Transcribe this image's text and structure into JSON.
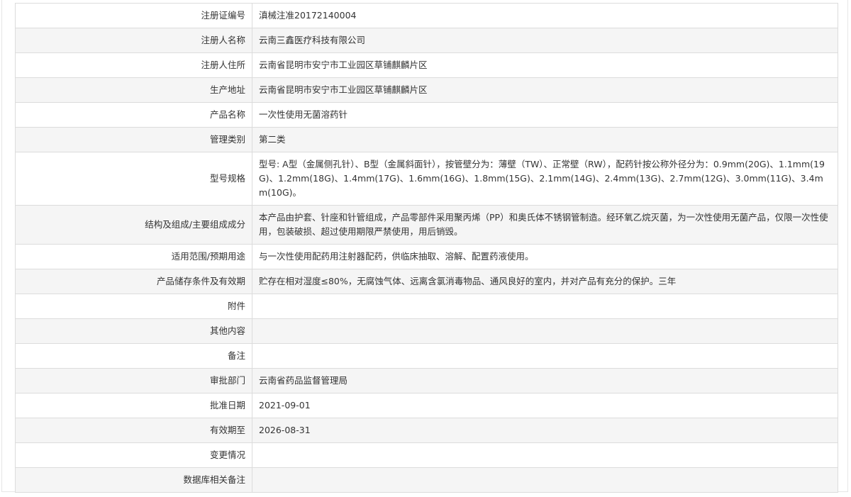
{
  "rows": [
    {
      "label": "注册证编号",
      "value": "滇械注准20172140004"
    },
    {
      "label": "注册人名称",
      "value": "云南三鑫医疗科技有限公司"
    },
    {
      "label": "注册人住所",
      "value": "云南省昆明市安宁市工业园区草铺麒麟片区"
    },
    {
      "label": "生产地址",
      "value": "云南省昆明市安宁市工业园区草铺麒麟片区"
    },
    {
      "label": "产品名称",
      "value": "一次性使用无菌溶药针"
    },
    {
      "label": "管理类别",
      "value": "第二类"
    },
    {
      "label": "型号规格",
      "value": "型号: A型（金属侧孔针）、B型（金属斜面针），按管壁分为：薄壁（TW）、正常壁（RW），配药针按公称外径分为：0.9mm(20G)、1.1mm(19G)、1.2mm(18G)、1.4mm(17G)、1.6mm(16G)、1.8mm(15G)、2.1mm(14G)、2.4mm(13G)、2.7mm(12G)、3.0mm(11G)、3.4mm(10G)。"
    },
    {
      "label": "结构及组成/主要组成成分",
      "value": "本产品由护套、针座和针管组成，产品零部件采用聚丙烯（PP）和奥氏体不锈钢管制造。经环氧乙烷灭菌，为一次性使用无菌产品，仅限一次性使用，包装破损、超过使用期限严禁使用，用后销毁。"
    },
    {
      "label": "适用范围/预期用途",
      "value": "与一次性使用配药用注射器配药，供临床抽取、溶解、配置药液使用。"
    },
    {
      "label": "产品储存条件及有效期",
      "value": "贮存在相对湿度≤80%，无腐蚀气体、远离含氯消毒物品、通风良好的室内，并对产品有充分的保护。三年"
    },
    {
      "label": "附件",
      "value": ""
    },
    {
      "label": "其他内容",
      "value": ""
    },
    {
      "label": "备注",
      "value": ""
    },
    {
      "label": "审批部门",
      "value": "云南省药品监督管理局"
    },
    {
      "label": "批准日期",
      "value": "2021-09-01"
    },
    {
      "label": "有效期至",
      "value": "2026-08-31"
    },
    {
      "label": "变更情况",
      "value": ""
    },
    {
      "label": "数据库相关备注",
      "value": ""
    }
  ]
}
